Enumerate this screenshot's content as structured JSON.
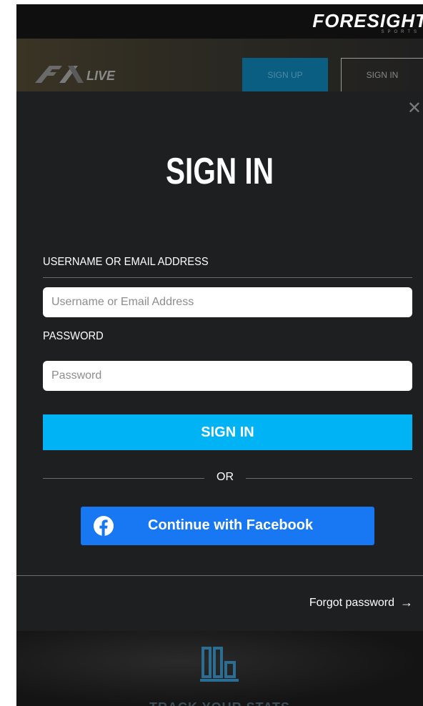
{
  "header": {
    "brand": "FORESIGHT",
    "brand_sub": "SPORTS",
    "signup_label": "SIGN UP",
    "signin_label": "SIGN IN"
  },
  "modal": {
    "title": "SIGN IN",
    "username_label": "USERNAME OR EMAIL ADDRESS",
    "username_placeholder": "Username or Email Address",
    "username_value": "",
    "password_label": "PASSWORD",
    "password_placeholder": "Password",
    "password_value": "",
    "signin_button": "SIGN IN",
    "or_text": "OR",
    "facebook_button": "Continue with Facebook",
    "forgot_password": "Forgot password",
    "close_glyph": "✕",
    "forgot_arrow": "→"
  },
  "background": {
    "track_text": "TRACK YOUR STATS"
  },
  "colors": {
    "accent": "#00b3f5",
    "facebook": "#1877f2",
    "modal_bg": "#1e1f21"
  },
  "icons": [
    "close-icon",
    "facebook-icon",
    "arrow-right-icon",
    "stats-icon",
    "fsx-live-logo"
  ]
}
